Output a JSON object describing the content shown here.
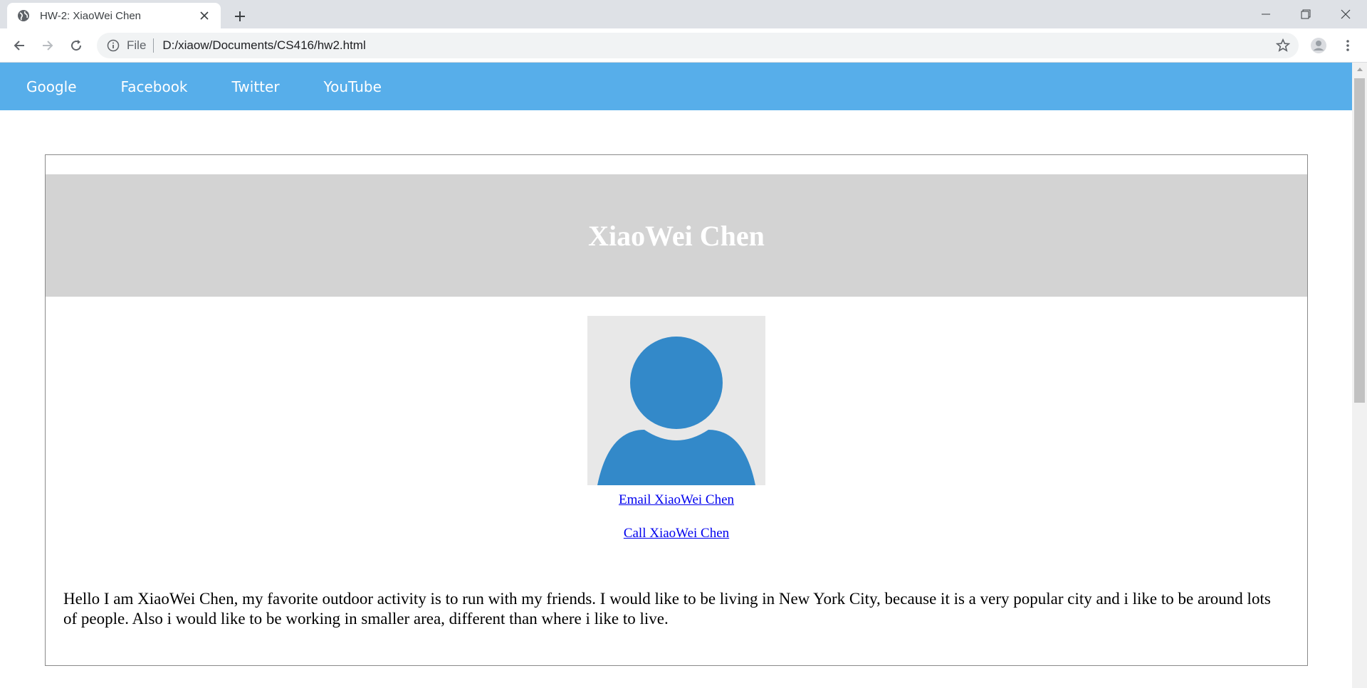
{
  "browser": {
    "tab_title": "HW-2: XiaoWei Chen",
    "address_scheme": "File",
    "address_url": "D:/xiaow/Documents/CS416/hw2.html",
    "icons": [
      "globe-icon",
      "close-icon",
      "plus-icon",
      "minimize-icon",
      "restore-icon",
      "window-close-icon",
      "back-arrow-icon",
      "forward-arrow-icon",
      "reload-icon",
      "info-icon",
      "star-icon",
      "profile-icon",
      "kebab-menu-icon"
    ]
  },
  "nav": {
    "background": "#57aeea",
    "links": [
      "Google",
      "Facebook",
      "Twitter",
      "YouTube"
    ]
  },
  "page": {
    "heading": "XiaoWei Chen",
    "avatar_icon": "user-silhouette-icon",
    "avatar_color": "#3389c9",
    "email_link": "Email XiaoWei Chen",
    "call_link": "Call XiaoWei Chen",
    "bio": "Hello I am XiaoWei Chen, my favorite outdoor activity is to run with my friends. I would like to be living in New York City, because it is a very popular city and i like to be around lots of people. Also i would like to be working in smaller area, different than where i like to live."
  }
}
